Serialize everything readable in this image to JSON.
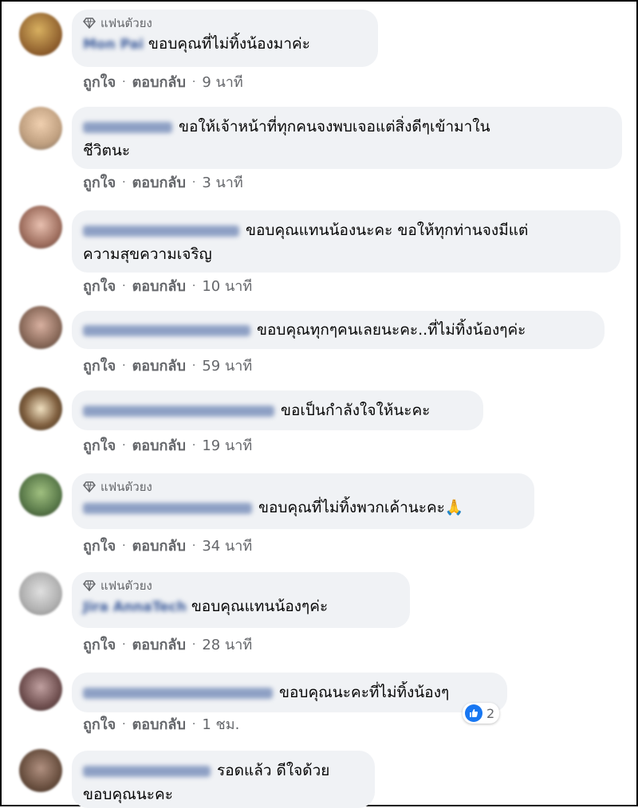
{
  "actions": {
    "like": "ถูกใจ",
    "reply": "ตอบกลับ",
    "dot": "·"
  },
  "fan_badge_label": "แฟนตัวยง",
  "comments": [
    {
      "name": "Mon Pai",
      "text": "ขอบคุณที่ไม่ทิ้งน้องมาค่ะ",
      "time": "9 นาที",
      "fan": true
    },
    {
      "name": "Tan sparrow",
      "text": "ขอให้เจ้าหน้าที่ทุกคนจงพบเจอแต่สิ่งดีๆเข้ามาใน",
      "text2": "ชีวิตนะ",
      "time": "3 นาที",
      "fan": false
    },
    {
      "name": "Punnitup Chaubi",
      "text": "ขอบคุณแทนน้องนะคะ ขอให้ทุกท่านจงมีแต่",
      "text2": "ความสุขความเจริญ",
      "time": "10 นาที",
      "fan": false
    },
    {
      "name": "Nattaphy Srithrani",
      "text": "ขอบคุณทุกๆคนเลยนะคะ..ที่ไม่ทิ้งน้องๆค่ะ",
      "time": "59 นาที",
      "fan": false
    },
    {
      "name": "Nanchaya Tongchan",
      "text": "ขอเป็นกำลังใจให้นะคะ",
      "time": "19 นาที",
      "fan": false
    },
    {
      "name": "เสลาวัลย์ เสนาวัลย์",
      "text": "ขอบคุณที่ไม่ทิ้งพวกเค้านะคะ🙏",
      "time": "34 นาที",
      "fan": true
    },
    {
      "name": "Jira AnnaTech",
      "text": "ขอบคุณแทนน้องๆค่ะ",
      "time": "28 นาที",
      "fan": true
    },
    {
      "name": "ภัสรา ลักษณ์ สุนาวัลย์",
      "text": "ขอบคุณนะคะที่ไม่ทิ้งน้องๆ",
      "time": "1 ชม.",
      "fan": false,
      "reactions": "2"
    },
    {
      "name": "Ayfin Jamtre",
      "text": "รอดแล้ว ดีใจด้วย",
      "text2": "ขอบคุณนะคะ",
      "time": "",
      "fan": false
    }
  ],
  "colors": {
    "bubble": "#f0f2f5",
    "action_text": "#65676b",
    "like_blue": "#1877f2"
  }
}
